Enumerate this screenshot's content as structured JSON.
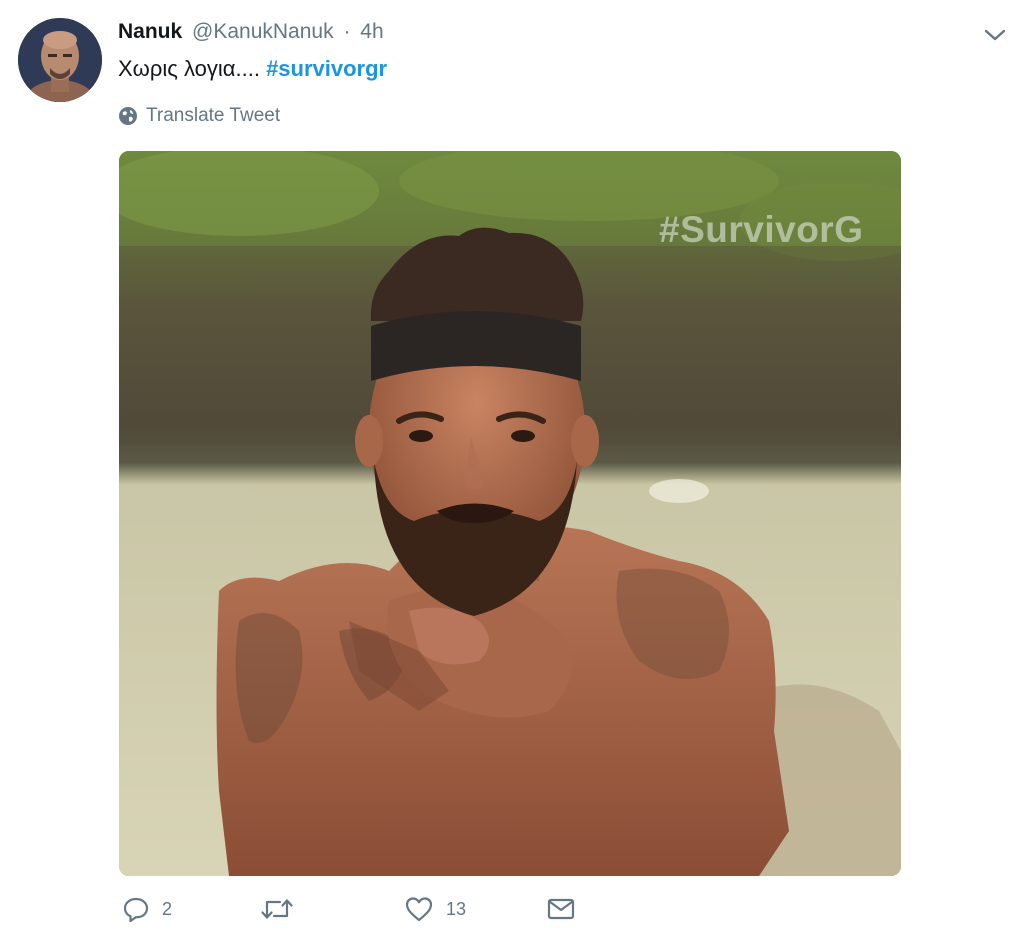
{
  "tweet": {
    "author_name": "Nanuk",
    "author_handle": "@KanukNanuk",
    "separator": "·",
    "time": "4h",
    "text": "Χωρις λογια....",
    "hashtag": "#survivorgr",
    "translate_label": "Translate Tweet",
    "media": {
      "watermark": "#SurvivorG"
    },
    "actions": {
      "reply_count": "2",
      "retweet_count": "",
      "like_count": "13"
    }
  },
  "colors": {
    "hashtag": "#1b95e0",
    "secondary_text": "#657786",
    "primary_text": "#14171a"
  },
  "icons": {
    "avatar": "avatar",
    "menu": "chevron-down-icon",
    "translate": "globe-icon",
    "reply": "reply-icon",
    "retweet": "retweet-icon",
    "like": "heart-icon",
    "message": "envelope-icon"
  }
}
